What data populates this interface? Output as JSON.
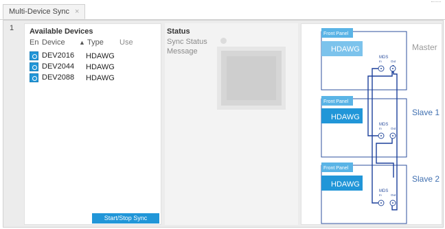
{
  "tab": {
    "label": "Multi-Device Sync",
    "close": "×"
  },
  "index_label": "1",
  "devices": {
    "title": "Available Devices",
    "columns": {
      "en": "En",
      "device": "Device",
      "sort": "▲",
      "type": "Type",
      "use": "Use"
    },
    "rows": [
      {
        "device": "DEV2016",
        "type": "HDAWG"
      },
      {
        "device": "DEV2044",
        "type": "HDAWG"
      },
      {
        "device": "DEV2088",
        "type": "HDAWG"
      }
    ],
    "button": "Start/Stop Sync"
  },
  "status": {
    "title": "Status",
    "sync_label": "Sync Status",
    "message_label": "Message"
  },
  "diagram": {
    "panels": [
      {
        "front": "Front Panel",
        "model": "HDAWG",
        "role": "Master",
        "mds": "MDS",
        "in": "In",
        "out": "Out"
      },
      {
        "front": "Front Panel",
        "model": "HDAWG",
        "role": "Slave 1",
        "mds": "MDS",
        "in": "In",
        "out": "Out"
      },
      {
        "front": "Front Panel",
        "model": "HDAWG",
        "role": "Slave 2",
        "mds": "MDS",
        "in": "In",
        "out": "Out"
      }
    ]
  },
  "colors": {
    "accent": "#2196d8",
    "accent_light": "#5ab4e6",
    "wire": "#1b3f9a"
  }
}
